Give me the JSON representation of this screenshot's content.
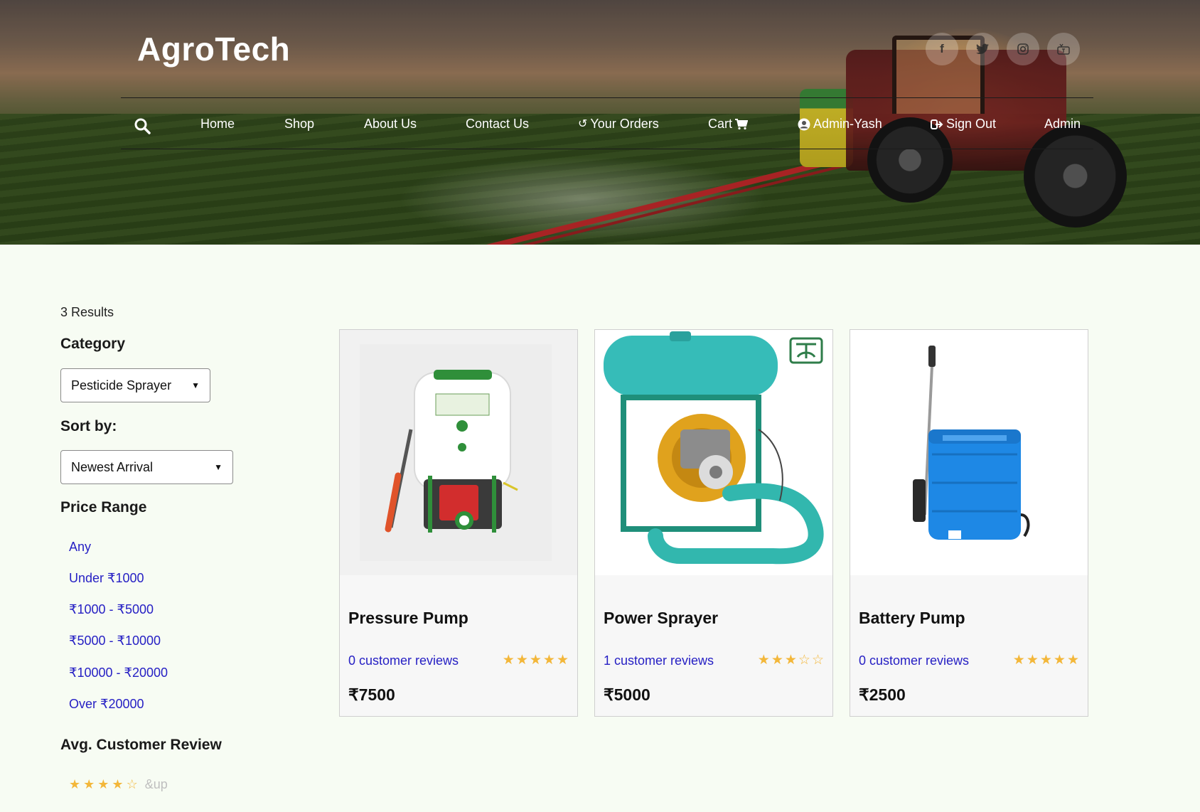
{
  "header": {
    "brand": "AgroTech",
    "socials": [
      {
        "name": "facebook-icon",
        "glyph": "f"
      },
      {
        "name": "twitter-icon",
        "glyph": "🐦"
      },
      {
        "name": "instagram-icon",
        "glyph": "◎"
      },
      {
        "name": "youtube-icon",
        "glyph": "▶"
      }
    ],
    "nav": {
      "home": "Home",
      "shop": "Shop",
      "about": "About Us",
      "contact": "Contact Us",
      "orders": "Your Orders",
      "cart": "Cart",
      "account": "Admin-Yash",
      "signout": "Sign Out",
      "admin": "Admin"
    }
  },
  "sidebar": {
    "results": "3 Results",
    "category_heading": "Category",
    "category_selected": "Pesticide Sprayer",
    "sort_heading": "Sort by:",
    "sort_selected": "Newest Arrival",
    "price_heading": "Price Range",
    "price_ranges": [
      "Any",
      "Under ₹1000",
      "₹1000 - ₹5000",
      "₹5000 - ₹10000",
      "₹10000 - ₹20000",
      "Over ₹20000"
    ],
    "review_heading": "Avg. Customer Review",
    "review_filter_stars": 4,
    "review_filter_suffix": "&up"
  },
  "products": [
    {
      "title": "Pressure Pump",
      "reviews": "0 customer reviews",
      "rating": 5,
      "price": "₹7500"
    },
    {
      "title": "Power Sprayer",
      "reviews": "1 customer reviews",
      "rating": 3,
      "price": "₹5000"
    },
    {
      "title": "Battery Pump",
      "reviews": "0 customer reviews",
      "rating": 5,
      "price": "₹2500"
    }
  ],
  "colors": {
    "page_bg": "#f7fcf3",
    "link": "#2620c4",
    "star": "#f3b73a"
  }
}
